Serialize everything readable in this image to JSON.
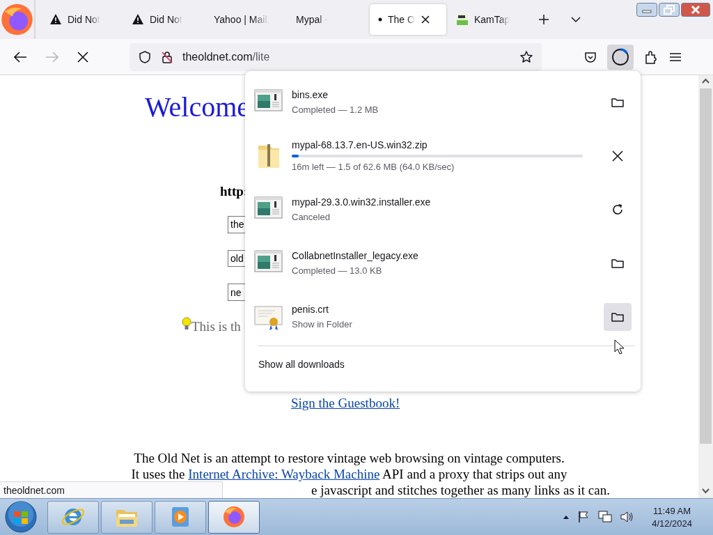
{
  "tabs": [
    {
      "kind": "warning",
      "label": "Did Not",
      "selected": false
    },
    {
      "kind": "warning",
      "label": "Did Not",
      "selected": false
    },
    {
      "kind": "plain",
      "label": "Yahoo | Mail,",
      "selected": false
    },
    {
      "kind": "plain",
      "label": "Mypal - ",
      "selected": false
    },
    {
      "kind": "loading",
      "label": "The O",
      "selected": true
    },
    {
      "kind": "site",
      "label": "KamTap",
      "selected": false
    }
  ],
  "toolbar": {
    "url_host": "theoldnet.com",
    "url_path": "/lite",
    "forward_disabled": true
  },
  "page": {
    "heading": "Welcome",
    "url_label": "http:",
    "fields": [
      "the",
      "old",
      "ne"
    ],
    "tip": "This is th",
    "guestbook_link": "Sign the Guestbook!",
    "paragraph": [
      {
        "text": "The Old Net is an attempt to restore vintage web browsing on vintage computers."
      },
      {
        "before": "It uses the ",
        "link": "Internet Archive: Wayback Machine",
        "after": " API and a proxy that strips out any"
      },
      {
        "text": "e javascript and stitches together as many links as it can."
      }
    ]
  },
  "downloads": {
    "items": [
      {
        "kind": "program",
        "name": "bins.exe",
        "status": "Completed — 1.2 MB",
        "action": {
          "kind": "folder",
          "hovered": false
        }
      },
      {
        "kind": "archive",
        "name": "mypal-68.13.7.en-US.win32.zip",
        "status": "16m left — 1.5 of 62.6 MB (64.0 KB/sec)",
        "action": {
          "kind": "cancel",
          "hovered": false
        },
        "level": 0.024
      },
      {
        "kind": "program",
        "name": "mypal-29.3.0.win32.installer.exe",
        "status": "Canceled",
        "action": {
          "kind": "retry",
          "hovered": false
        }
      },
      {
        "kind": "program",
        "name": "CollabnetInstaller_legacy.exe",
        "status": "Completed — 13.0 KB",
        "action": {
          "kind": "folder",
          "hovered": false
        }
      },
      {
        "kind": "certificate",
        "name": "penis.crt",
        "status": "Show in Folder",
        "action": {
          "kind": "folder",
          "hovered": true
        }
      }
    ],
    "footer": "Show all downloads"
  },
  "status_bar": "theoldnet.com",
  "taskbar": {
    "apps": [
      {
        "kind": "ie",
        "selected": false
      },
      {
        "kind": "explorer",
        "selected": false
      },
      {
        "kind": "media",
        "selected": false
      },
      {
        "kind": "firefox",
        "selected": true
      }
    ],
    "time": "11:49 AM",
    "date": "4/12/2024"
  }
}
